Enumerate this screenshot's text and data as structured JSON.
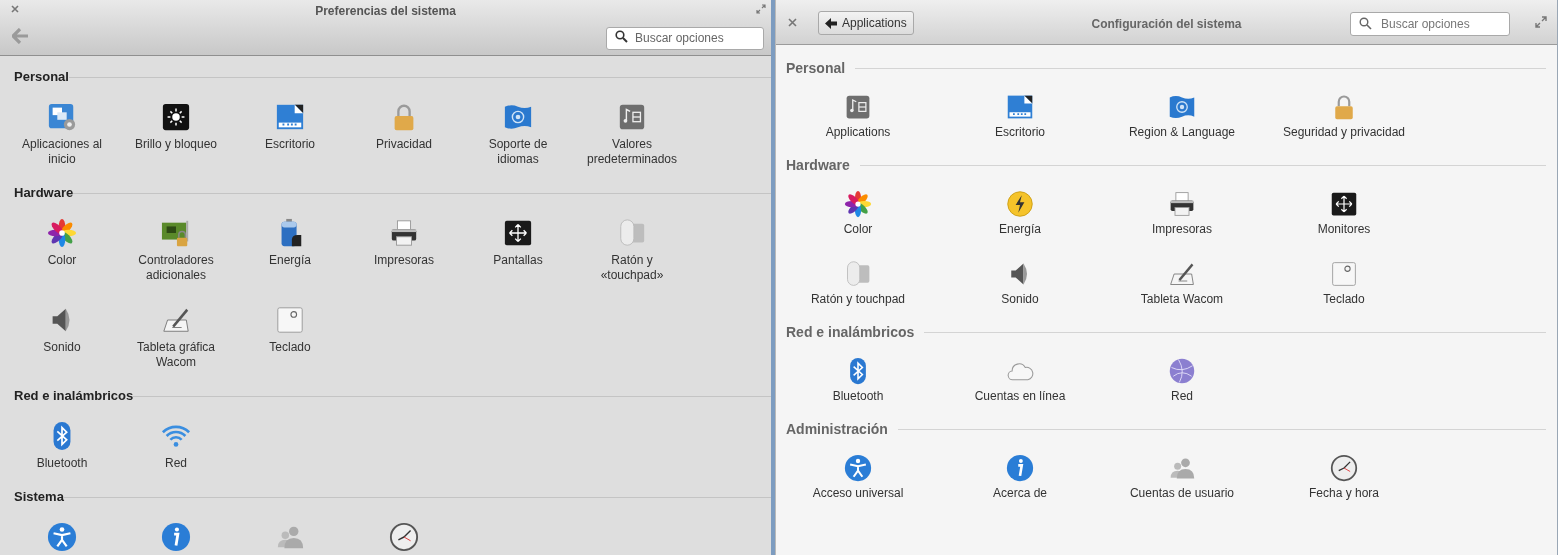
{
  "left_window": {
    "title": "Preferencias del sistema",
    "search": {
      "placeholder": "Buscar opciones"
    },
    "sections": [
      {
        "heading": "Personal",
        "items": [
          {
            "label": "Aplicaciones al\ninicio",
            "kind": "startup"
          },
          {
            "label": "Brillo y bloqueo",
            "kind": "brightness"
          },
          {
            "label": "Escritorio",
            "kind": "desktop"
          },
          {
            "label": "Privacidad",
            "kind": "lock"
          },
          {
            "label": "Soporte de\nidiomas",
            "kind": "flag"
          },
          {
            "label": "Valores\npredeterminados",
            "kind": "defaults"
          }
        ]
      },
      {
        "heading": "Hardware",
        "items": [
          {
            "label": "Color",
            "kind": "color"
          },
          {
            "label": "Controladores\nadicionales",
            "kind": "board"
          },
          {
            "label": "Energía",
            "kind": "battery"
          },
          {
            "label": "Impresoras",
            "kind": "printer"
          },
          {
            "label": "Pantallas",
            "kind": "display"
          },
          {
            "label": "Ratón y\n«touchpad»",
            "kind": "mouse"
          },
          {
            "label": "Sonido",
            "kind": "speaker"
          },
          {
            "label": "Tableta gráfica\nWacom",
            "kind": "tablet"
          },
          {
            "label": "Teclado",
            "kind": "keyboard"
          }
        ]
      },
      {
        "heading": "Red e inalámbricos",
        "items": [
          {
            "label": "Bluetooth",
            "kind": "bluetooth"
          },
          {
            "label": "Red",
            "kind": "wifi"
          }
        ]
      },
      {
        "heading": "Sistema",
        "items": [
          {
            "kind": "accessibility"
          },
          {
            "kind": "info"
          },
          {
            "kind": "users"
          },
          {
            "kind": "clock"
          }
        ]
      }
    ]
  },
  "right_window": {
    "back_button": "Applications",
    "title": "Configuración del sistema",
    "search": {
      "placeholder": "Buscar opciones"
    },
    "sections": [
      {
        "heading": "Personal",
        "items": [
          {
            "label": "Applications",
            "kind": "defaults"
          },
          {
            "label": "Escritorio",
            "kind": "desktop"
          },
          {
            "label": "Region & Language",
            "kind": "flag"
          },
          {
            "label": "Seguridad y privacidad",
            "kind": "lock"
          }
        ]
      },
      {
        "heading": "Hardware",
        "items": [
          {
            "label": "Color",
            "kind": "color"
          },
          {
            "label": "Energía",
            "kind": "bolt"
          },
          {
            "label": "Impresoras",
            "kind": "printer"
          },
          {
            "label": "Monitores",
            "kind": "display"
          },
          {
            "label": "Ratón y touchpad",
            "kind": "mouse"
          },
          {
            "label": "Sonido",
            "kind": "speaker"
          },
          {
            "label": "Tableta Wacom",
            "kind": "tablet"
          },
          {
            "label": "Teclado",
            "kind": "keyboard"
          }
        ]
      },
      {
        "heading": "Red e inalámbricos",
        "items": [
          {
            "label": "Bluetooth",
            "kind": "bluetooth"
          },
          {
            "label": "Cuentas en línea",
            "kind": "cloud"
          },
          {
            "label": "Red",
            "kind": "globe"
          }
        ]
      },
      {
        "heading": "Administración",
        "items": [
          {
            "label": "Acceso universal",
            "kind": "accessibility"
          },
          {
            "label": "Acerca de",
            "kind": "info"
          },
          {
            "label": "Cuentas de usuario",
            "kind": "users"
          },
          {
            "label": "Fecha y hora",
            "kind": "clock"
          }
        ]
      }
    ]
  }
}
